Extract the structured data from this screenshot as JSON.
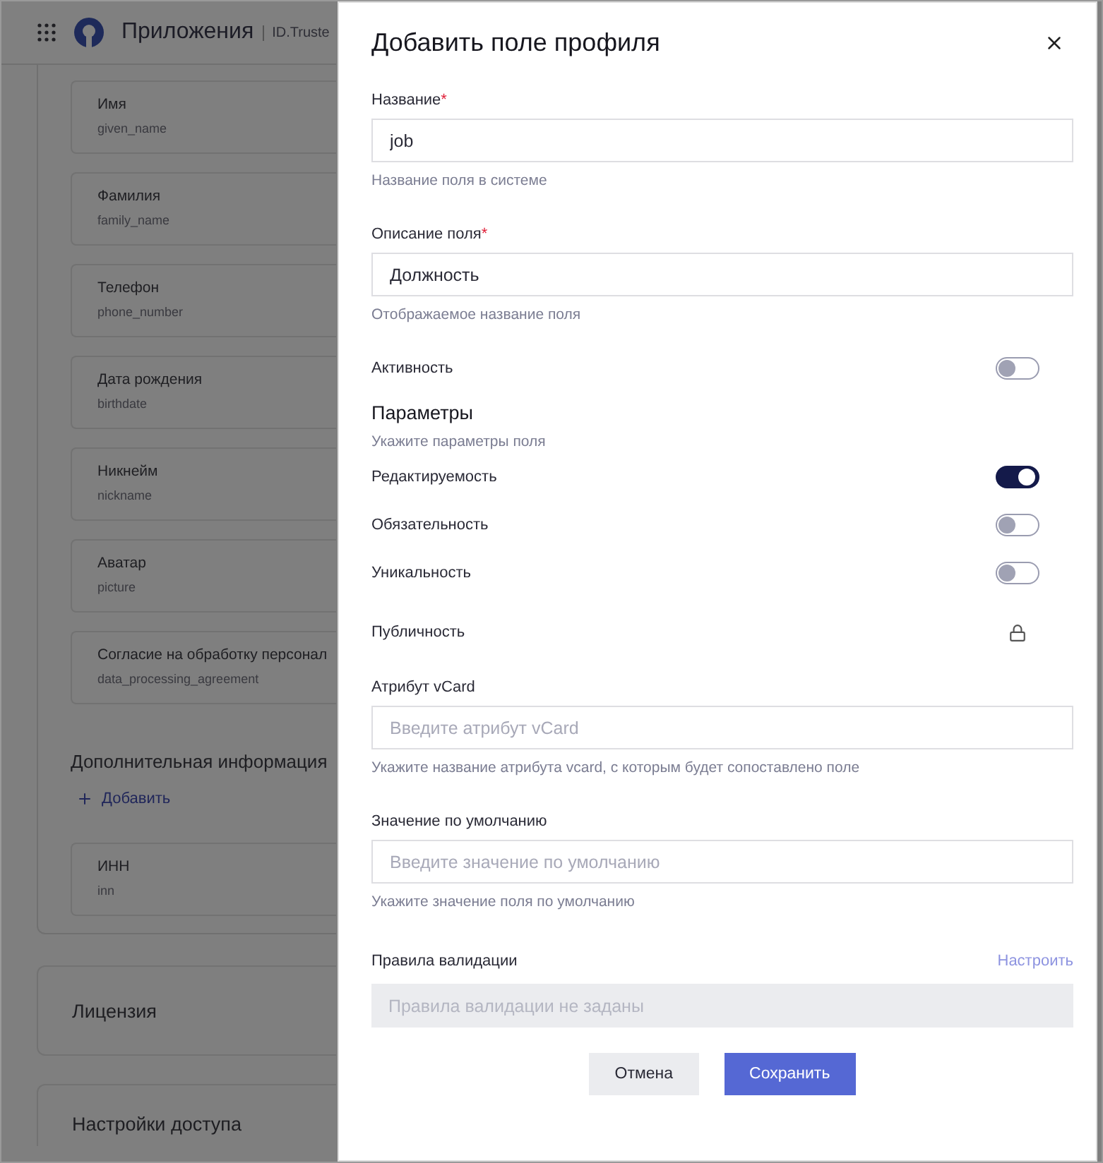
{
  "header": {
    "app_title": "Приложения",
    "breadcrumb": "ID.Truste"
  },
  "profile_fields": [
    {
      "title": "Имя",
      "key": "given_name"
    },
    {
      "title": "Фамилия",
      "key": "family_name"
    },
    {
      "title": "Телефон",
      "key": "phone_number"
    },
    {
      "title": "Дата рождения",
      "key": "birthdate"
    },
    {
      "title": "Никнейм",
      "key": "nickname"
    },
    {
      "title": "Аватар",
      "key": "picture"
    },
    {
      "title": "Согласие на обработку персонал",
      "key": "data_processing_agreement"
    }
  ],
  "additional": {
    "heading": "Дополнительная информация",
    "add_label": "Добавить",
    "fields": [
      {
        "title": "ИНН",
        "key": "inn"
      }
    ]
  },
  "sections": [
    {
      "title": "Лицензия"
    },
    {
      "title": "Настройки доступа"
    }
  ],
  "dialog": {
    "title": "Добавить поле профиля",
    "name_field": {
      "label": "Название",
      "required_mark": "*",
      "value": "job",
      "hint": "Название поля в системе"
    },
    "description_field": {
      "label": "Описание поля",
      "required_mark": "*",
      "value": "Должность",
      "hint": "Отображаемое название поля"
    },
    "active": {
      "label": "Активность",
      "on": false
    },
    "parameters": {
      "heading": "Параметры",
      "hint": "Укажите параметры поля",
      "toggles": [
        {
          "label": "Редактируемость",
          "on": true
        },
        {
          "label": "Обязательность",
          "on": false
        },
        {
          "label": "Уникальность",
          "on": false
        }
      ],
      "public": {
        "label": "Публичность",
        "locked": true
      }
    },
    "vcard": {
      "label": "Атрибут vCard",
      "placeholder": "Введите атрибут vCard",
      "hint": "Укажите название атрибута vcard, с которым будет сопоставлено поле"
    },
    "default_value": {
      "label": "Значение по умолчанию",
      "placeholder": "Введите значение по умолчанию",
      "hint": "Укажите значение поля по умолчанию"
    },
    "validation": {
      "label": "Правила валидации",
      "action": "Настроить",
      "empty_text": "Правила валидации не заданы"
    },
    "buttons": [
      {
        "label": "Отмена",
        "kind": "secondary"
      },
      {
        "label": "Сохранить",
        "kind": "primary"
      }
    ]
  }
}
